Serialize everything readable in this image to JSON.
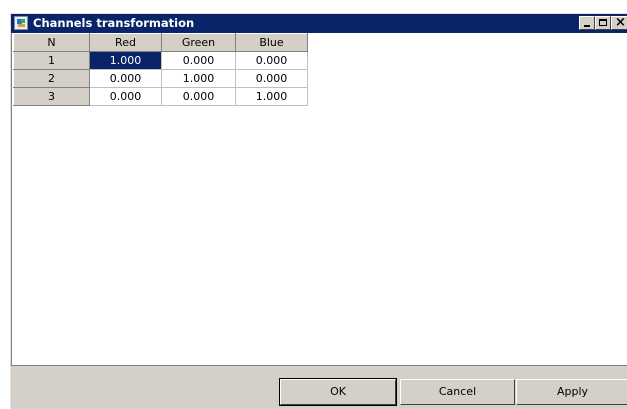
{
  "window": {
    "title": "Channels transformation",
    "icon": "app-icon",
    "controls": {
      "minimize": "minimize-icon",
      "maximize": "maximize-icon",
      "close": "×"
    }
  },
  "table": {
    "headers": [
      "N",
      "Red",
      "Green",
      "Blue"
    ],
    "rows": [
      [
        "1",
        "1.000",
        "0.000",
        "0.000"
      ],
      [
        "2",
        "0.000",
        "1.000",
        "0.000"
      ],
      [
        "3",
        "0.000",
        "0.000",
        "1.000"
      ]
    ],
    "selected_cell": {
      "row": 0,
      "col": 1
    }
  },
  "buttons": {
    "ok": "OK",
    "cancel": "Cancel",
    "apply": "Apply"
  },
  "colors": {
    "titlebar": "#0a246a",
    "selection": "#0a246a",
    "face": "#d4d0c8"
  }
}
